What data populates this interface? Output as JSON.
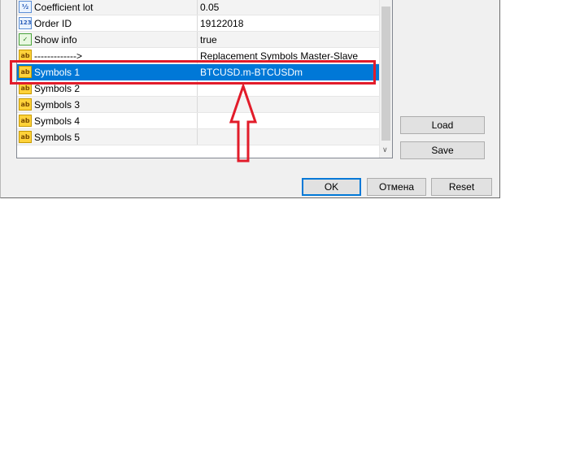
{
  "grid": {
    "rows": [
      {
        "icon": "fraction-icon",
        "icon_text": "½",
        "name": "Coefficient lot",
        "value": "0.05"
      },
      {
        "icon": "number-icon",
        "icon_text": "123",
        "name": "Order ID",
        "value": "19122018"
      },
      {
        "icon": "boolean-icon",
        "icon_text": "✓",
        "name": "Show info",
        "value": "true"
      },
      {
        "icon": "string-icon",
        "icon_text": "ab",
        "name": "------------->",
        "value": "Replacement Symbols Master-Slave"
      },
      {
        "icon": "string-icon",
        "icon_text": "ab",
        "name": "Symbols 1",
        "value": "BTCUSD.m-BTCUSDm"
      },
      {
        "icon": "string-icon",
        "icon_text": "ab",
        "name": "Symbols 2",
        "value": ""
      },
      {
        "icon": "string-icon",
        "icon_text": "ab",
        "name": "Symbols 3",
        "value": ""
      },
      {
        "icon": "string-icon",
        "icon_text": "ab",
        "name": "Symbols 4",
        "value": ""
      },
      {
        "icon": "string-icon",
        "icon_text": "ab",
        "name": "Symbols 5",
        "value": ""
      }
    ]
  },
  "side_buttons": {
    "load": "Load",
    "save": "Save"
  },
  "footer_buttons": {
    "ok": "OK",
    "cancel": "Отмена",
    "reset": "Reset"
  },
  "colors": {
    "selection": "#0078d7",
    "highlight": "#e21c2a"
  }
}
